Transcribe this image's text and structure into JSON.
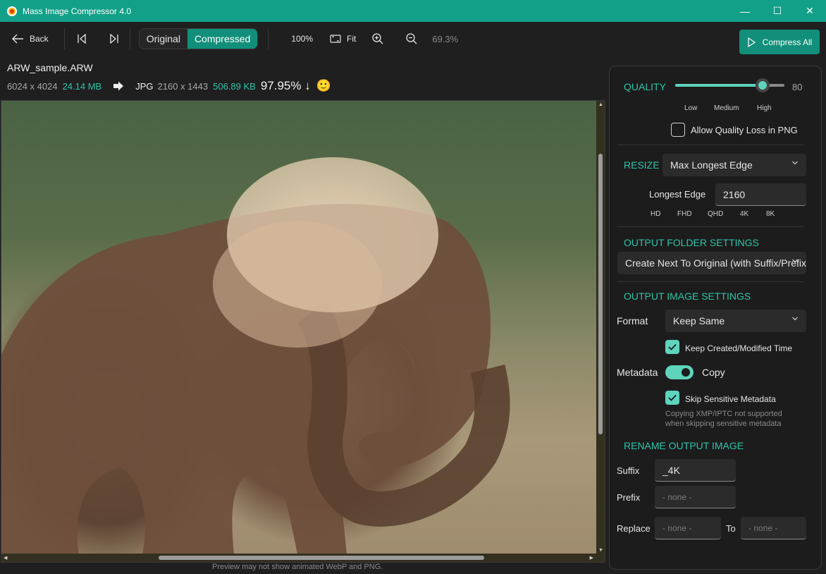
{
  "window": {
    "title": "Mass Image Compressor 4.0",
    "controls": {
      "minimize": "—",
      "maximize": "☐",
      "close": "✕"
    }
  },
  "toolbar": {
    "back_label": "Back",
    "view_original": "Original",
    "view_compressed": "Compressed",
    "active_view": "Compressed",
    "zoom_100": "100%",
    "fit": "Fit",
    "zoom_level": "69.3%",
    "compress_all": "Compress All"
  },
  "file": {
    "name": "ARW_sample.ARW",
    "orig_dims": "6024 x 4024",
    "orig_size": "24.14 MB",
    "out_format": "JPG",
    "out_dims": "2160 x 1443",
    "out_size": "506.89 KB",
    "reduction": "97.95% ↓",
    "emoji": "🙂"
  },
  "preview": {
    "note": "Preview may not show animated WebP and PNG.",
    "image_label": "Elephant dust-bathing photo"
  },
  "quality": {
    "title": "QUALITY",
    "value": "80",
    "level_fraction": 0.8,
    "labels": [
      "Low",
      "Medium",
      "High"
    ],
    "allow_loss_png": "Allow Quality Loss in PNG",
    "allow_loss_png_checked": false
  },
  "resize": {
    "title": "RESIZE",
    "mode": "Max Longest Edge",
    "longest_edge_label": "Longest Edge",
    "longest_edge_value": "2160",
    "presets": [
      "HD",
      "FHD",
      "QHD",
      "4K",
      "8K"
    ]
  },
  "output_folder": {
    "title": "OUTPUT FOLDER SETTINGS",
    "mode": "Create Next To Original (with Suffix/Prefix)"
  },
  "output_image": {
    "title": "OUTPUT IMAGE SETTINGS",
    "format_label": "Format",
    "format_value": "Keep Same",
    "keep_time": "Keep Created/Modified Time",
    "metadata_label": "Metadata",
    "metadata_toggle": "Copy",
    "skip_sensitive": "Skip Sensitive Metadata",
    "skip_note_1": "Copying XMP/IPTC not supported",
    "skip_note_2": "when skipping sensitive metadata"
  },
  "rename": {
    "title": "RENAME OUTPUT IMAGE",
    "suffix_label": "Suffix",
    "suffix_value": "_4K",
    "prefix_label": "Prefix",
    "prefix_placeholder": "- none -",
    "replace_label": "Replace",
    "replace_placeholder": "- none -",
    "to_label": "To",
    "to_placeholder": "- none -"
  },
  "colors": {
    "accent": "#128f7a",
    "accent_light": "#5fd4bd",
    "accent_text": "#2ec4a8",
    "titlebar": "#13a089"
  }
}
